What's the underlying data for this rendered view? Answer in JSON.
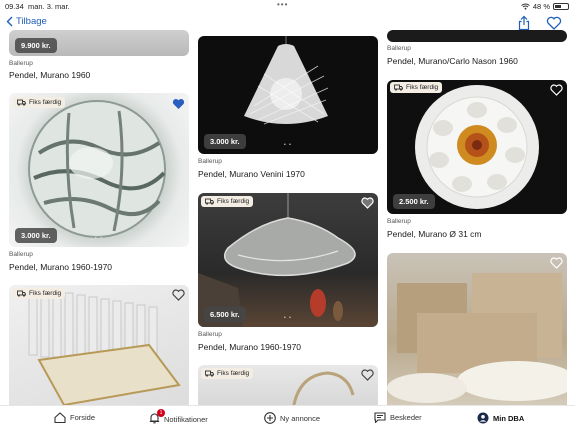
{
  "status": {
    "time": "09.34",
    "date": "man. 3. mar.",
    "battery": "48 %"
  },
  "nav": {
    "back_label": "Tilbage"
  },
  "badge_label": "Fiks færdig",
  "cards": [
    {
      "price": "9.900 kr.",
      "location": "Ballerup",
      "title": "Pendel, Murano 1960"
    },
    {
      "price": "3.000 kr.",
      "location": "Ballerup",
      "title": "Pendel, Murano 1960-1970"
    },
    {
      "location": "",
      "title": ""
    },
    {
      "price": "3.000 kr.",
      "location": "Ballerup",
      "title": "Pendel, Murano Venini 1970"
    },
    {
      "price": "6.500 kr.",
      "location": "Ballerup",
      "title": "Pendel, Murano 1960-1970"
    },
    {
      "location": "Ballerup",
      "title": "Pendel, Murano/Carlo Nason 1960"
    },
    {
      "price": "2.500 kr.",
      "location": "Ballerup",
      "title": "Pendel, Murano Ø 31 cm"
    }
  ],
  "tabs": [
    {
      "label": "Forside"
    },
    {
      "label": "Notifikationer",
      "count": "1"
    },
    {
      "label": "Ny annonce"
    },
    {
      "label": "Beskeder"
    },
    {
      "label": "Min DBA"
    }
  ]
}
